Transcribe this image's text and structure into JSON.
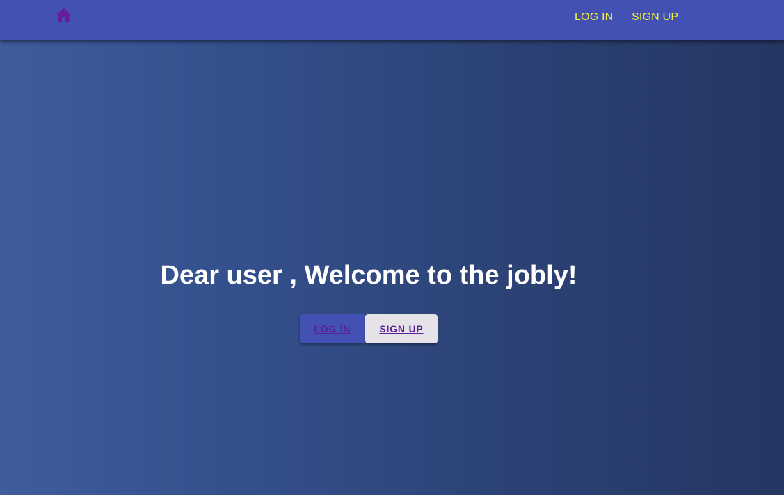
{
  "navbar": {
    "home_icon": "home-icon",
    "login_label": "LOG IN",
    "signup_label": "SIGN UP",
    "colors": {
      "background": "#4351b5",
      "link": "#f3ef3b",
      "home_icon": "#6a1b9a"
    }
  },
  "hero": {
    "title": "Dear user , Welcome to the jobly!",
    "login_button": "LOG IN",
    "signup_button": "SIGN UP"
  }
}
